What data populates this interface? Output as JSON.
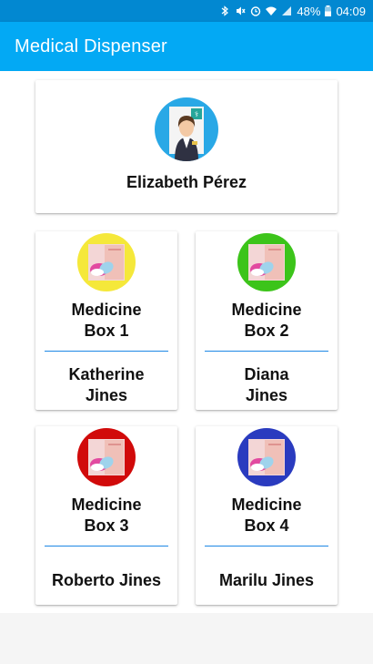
{
  "statusbar": {
    "battery": "48%",
    "time": "04:09",
    "icons": [
      "bluetooth-icon",
      "mute-icon",
      "alarm-icon",
      "wifi-icon",
      "signal-icon",
      "battery-icon"
    ]
  },
  "appbar": {
    "title": "Medical Dispenser"
  },
  "profile": {
    "name": "Elizabeth Pérez",
    "avatar_icon": "doctor-avatar-icon"
  },
  "boxes": [
    {
      "title_line1": "Medicine",
      "title_line2": "Box 1",
      "owner_line1": "Katherine",
      "owner_line2": "Jines",
      "color": "#f5e83a"
    },
    {
      "title_line1": "Medicine",
      "title_line2": "Box 2",
      "owner_line1": "Diana",
      "owner_line2": "Jines",
      "color": "#3cc41a"
    },
    {
      "title_line1": "Medicine",
      "title_line2": "Box 3",
      "owner": "Roberto Jines",
      "color": "#d10a0a"
    },
    {
      "title_line1": "Medicine",
      "title_line2": "Box 4",
      "owner": "Marilu Jines",
      "color": "#2a3bbf"
    }
  ],
  "colors": {
    "appbar": "#03a9f4",
    "statusbar": "#0288d1",
    "divider": "#1e88e5"
  }
}
